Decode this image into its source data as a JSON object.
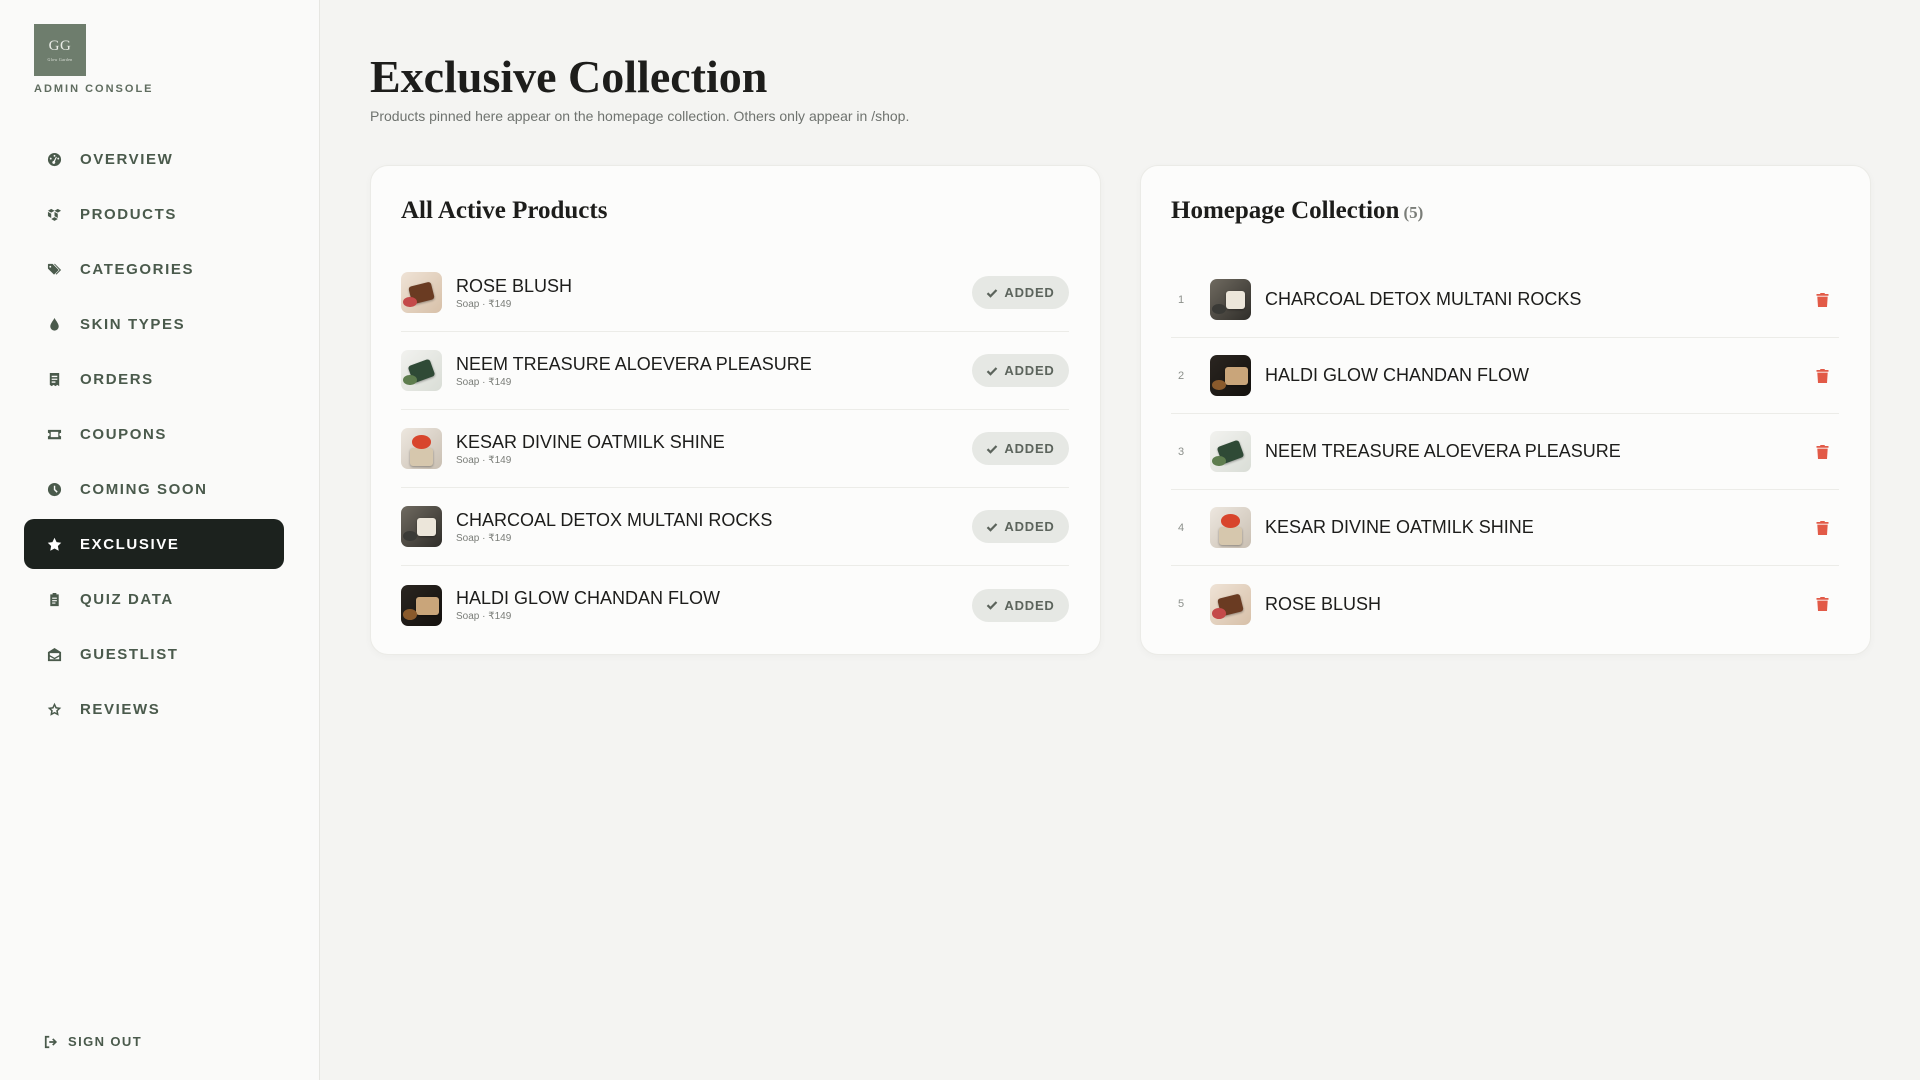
{
  "brand": {
    "monogram": "GG",
    "logo_subtext": "Glow Garden",
    "console_label": "ADMIN CONSOLE",
    "logo_color": "#6e7d6d"
  },
  "sidebar": {
    "items": [
      {
        "label": "OVERVIEW",
        "icon": "gauge-icon",
        "active": false
      },
      {
        "label": "PRODUCTS",
        "icon": "boxes-icon",
        "active": false
      },
      {
        "label": "CATEGORIES",
        "icon": "tags-icon",
        "active": false
      },
      {
        "label": "SKIN TYPES",
        "icon": "droplet-icon",
        "active": false
      },
      {
        "label": "ORDERS",
        "icon": "receipt-icon",
        "active": false
      },
      {
        "label": "COUPONS",
        "icon": "ticket-icon",
        "active": false
      },
      {
        "label": "COMING SOON",
        "icon": "clock-icon",
        "active": false
      },
      {
        "label": "EXCLUSIVE",
        "icon": "star-icon",
        "active": true
      },
      {
        "label": "QUIZ DATA",
        "icon": "clipboard-icon",
        "active": false
      },
      {
        "label": "GUESTLIST",
        "icon": "envelope-open-icon",
        "active": false
      },
      {
        "label": "REVIEWS",
        "icon": "star-outline-icon",
        "active": false
      }
    ],
    "signout_label": "SIGN OUT",
    "active_color": "#1c221e"
  },
  "page": {
    "title": "Exclusive Collection",
    "subtitle": "Products pinned here appear on the homepage collection. Others only appear in /shop."
  },
  "all_products": {
    "title": "All Active Products",
    "button_label": "ADDED",
    "items": [
      {
        "name": "ROSE BLUSH",
        "meta": "Soap · ₹149"
      },
      {
        "name": "NEEM TREASURE ALOEVERA PLEASURE",
        "meta": "Soap · ₹149"
      },
      {
        "name": "KESAR DIVINE OATMILK SHINE",
        "meta": "Soap · ₹149"
      },
      {
        "name": "CHARCOAL DETOX MULTANI ROCKS",
        "meta": "Soap · ₹149"
      },
      {
        "name": "HALDI GLOW CHANDAN FLOW",
        "meta": "Soap · ₹149"
      }
    ]
  },
  "homepage_collection": {
    "title": "Homepage Collection",
    "count": "(5)",
    "items": [
      {
        "index": "1",
        "name": "CHARCOAL DETOX MULTANI ROCKS"
      },
      {
        "index": "2",
        "name": "HALDI GLOW CHANDAN FLOW"
      },
      {
        "index": "3",
        "name": "NEEM TREASURE ALOEVERA PLEASURE"
      },
      {
        "index": "4",
        "name": "KESAR DIVINE OATMILK SHINE"
      },
      {
        "index": "5",
        "name": "ROSE BLUSH"
      }
    ],
    "delete_color": "#e25a47"
  }
}
